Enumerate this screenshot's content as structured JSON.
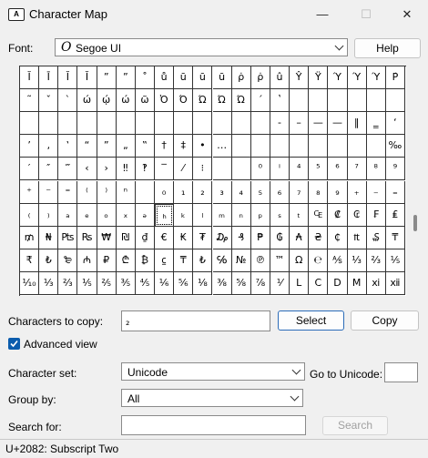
{
  "window": {
    "title": "Character Map",
    "app_icon_text": "A",
    "minimize_glyph": "—",
    "maximize_glyph": "☐",
    "close_glyph": "✕"
  },
  "font": {
    "label": "Font:",
    "icon_glyph": "O",
    "value": "Segoe UI",
    "help_label": "Help"
  },
  "grid": {
    "columns": 20,
    "selected_row": 6,
    "selected_col": 7,
    "rows": [
      [
        "Ĭ",
        "Ī",
        "Ĭ",
        "Ĭ",
        "”",
        "”",
        "˚",
        "ů",
        "ū",
        "ū",
        "ū",
        "ρ̇",
        "ρ̇",
        "û",
        "Ŷ",
        "Ÿ",
        "Ύ",
        "Ύ",
        "Ύ",
        "Ρ̇"
      ],
      [
        "˜",
        "ˇ",
        "`",
        "ώ",
        "ῴ",
        "ώ",
        "ῶ",
        "Ὀ",
        "Ό",
        "Ώ",
        "Ώ",
        "Ώ",
        "´",
        "ʽ",
        "",
        "",
        "",
        "",
        "",
        ""
      ],
      [
        "",
        "",
        "",
        "",
        "",
        "",
        "",
        "",
        "",
        "",
        "",
        "",
        "",
        "‐",
        "–",
        "—",
        "—",
        "‖",
        "‗",
        "‘"
      ],
      [
        "’",
        "‚",
        "‛",
        "“",
        "”",
        "„",
        "‟",
        "†",
        "‡",
        "•",
        "…",
        "",
        "",
        "",
        "",
        "",
        "",
        "",
        "",
        "‰"
      ],
      [
        "′",
        "″",
        "‴",
        "‹",
        "›",
        "‼",
        "‽",
        "‾",
        "⁄",
        "⁝",
        "",
        "",
        "⁰",
        "ⁱ",
        "⁴",
        "⁵",
        "⁶",
        "⁷",
        "⁸",
        "⁹"
      ],
      [
        "⁺",
        "⁻",
        "⁼",
        "⁽",
        "⁾",
        "ⁿ",
        "",
        "₀",
        "₁",
        "₂",
        "₃",
        "₄",
        "₅",
        "₆",
        "₇",
        "₈",
        "₉",
        "₊",
        "₋",
        "₌"
      ],
      [
        "₍",
        "₎",
        "ₐ",
        "ₑ",
        "ₒ",
        "ₓ",
        "ₔ",
        "ₕ",
        "ₖ",
        "ₗ",
        "ₘ",
        "ₙ",
        "ₚ",
        "ₛ",
        "ₜ",
        "₠",
        "₡",
        "₢",
        "₣",
        "₤"
      ],
      [
        "₥",
        "₦",
        "₧",
        "₨",
        "₩",
        "₪",
        "₫",
        "€",
        "₭",
        "₮",
        "₯",
        "₰",
        "₱",
        "₲",
        "₳",
        "₴",
        "₵",
        "₶",
        "₷",
        "₸"
      ],
      [
        "₹",
        "₺",
        "₻",
        "₼",
        "₽",
        "₾",
        "₿",
        "⃀",
        "₸",
        "₺",
        "℅",
        "№",
        "℗",
        "™",
        "Ω",
        "℮",
        "⅍",
        "⅓",
        "⅔",
        "⅕"
      ],
      [
        "⅒",
        "⅓",
        "⅔",
        "⅕",
        "⅖",
        "⅗",
        "⅘",
        "⅙",
        "⅚",
        "⅛",
        "⅜",
        "⅝",
        "⅞",
        "⅟",
        "Ⅼ",
        "Ⅽ",
        "Ⅾ",
        "Ⅿ",
        "ⅺ",
        "ⅻ"
      ]
    ]
  },
  "copy": {
    "label": "Characters to copy:",
    "value": "₂",
    "select_label": "Select",
    "copy_label": "Copy"
  },
  "advanced": {
    "label": "Advanced view",
    "checked": true
  },
  "character_set": {
    "label": "Character set:",
    "value": "Unicode"
  },
  "goto_unicode": {
    "label": "Go to Unicode:",
    "value": ""
  },
  "group_by": {
    "label": "Group by:",
    "value": "All"
  },
  "search": {
    "label": "Search for:",
    "value": "",
    "button_label": "Search"
  },
  "status": {
    "text": "U+2082: Subscript Two"
  }
}
